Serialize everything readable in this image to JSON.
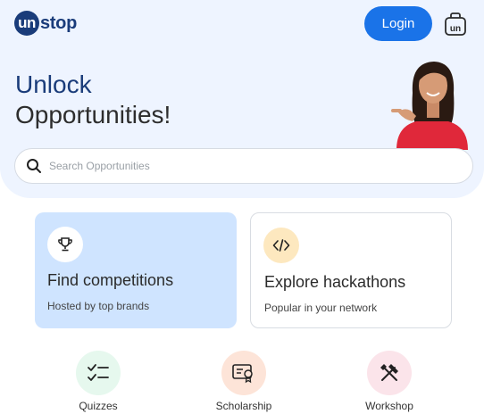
{
  "header": {
    "logo_mark": "un",
    "logo_text": "stop",
    "login_label": "Login",
    "bag_icon_text": "un"
  },
  "hero": {
    "headline_line1": "Unlock",
    "headline_line2": "Opportunities!"
  },
  "search": {
    "placeholder": "Search Opportunities"
  },
  "cards": [
    {
      "title": "Find competitions",
      "subtitle": "Hosted by top brands",
      "icon": "trophy-icon"
    },
    {
      "title": "Explore hackathons",
      "subtitle": "Popular in your network",
      "icon": "code-icon"
    }
  ],
  "categories": [
    {
      "label": "Quizzes",
      "icon": "checklist-icon"
    },
    {
      "label": "Scholarship",
      "icon": "certificate-icon"
    },
    {
      "label": "Workshop",
      "icon": "tools-icon"
    }
  ],
  "colors": {
    "brand": "#1a3c7a",
    "accent": "#1a73e8",
    "hero_bg": "#eef4ff",
    "card_highlight": "#cfe4ff"
  }
}
